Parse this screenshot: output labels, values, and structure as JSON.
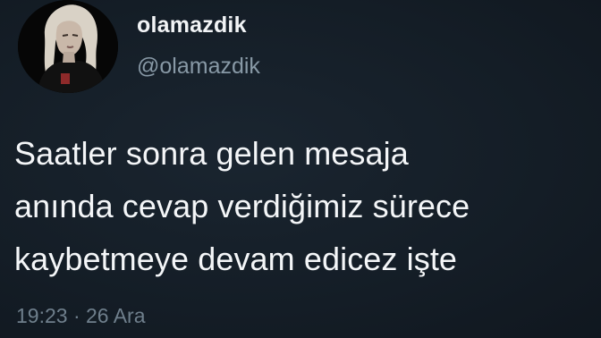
{
  "tweet": {
    "display_name": "olamazdik",
    "handle": "@olamazdik",
    "text_lines": [
      "Saatler sonra gelen mesaja",
      "anında cevap verdiğimiz sürece",
      "kaybetmeye devam edicez işte"
    ],
    "time": "19:23",
    "separator": "·",
    "date": "26 Ara"
  },
  "colors": {
    "background": "#141d26",
    "text": "#f4f6f8",
    "secondary": "#8899a6"
  },
  "icons": {
    "avatar": "profile-photo"
  }
}
